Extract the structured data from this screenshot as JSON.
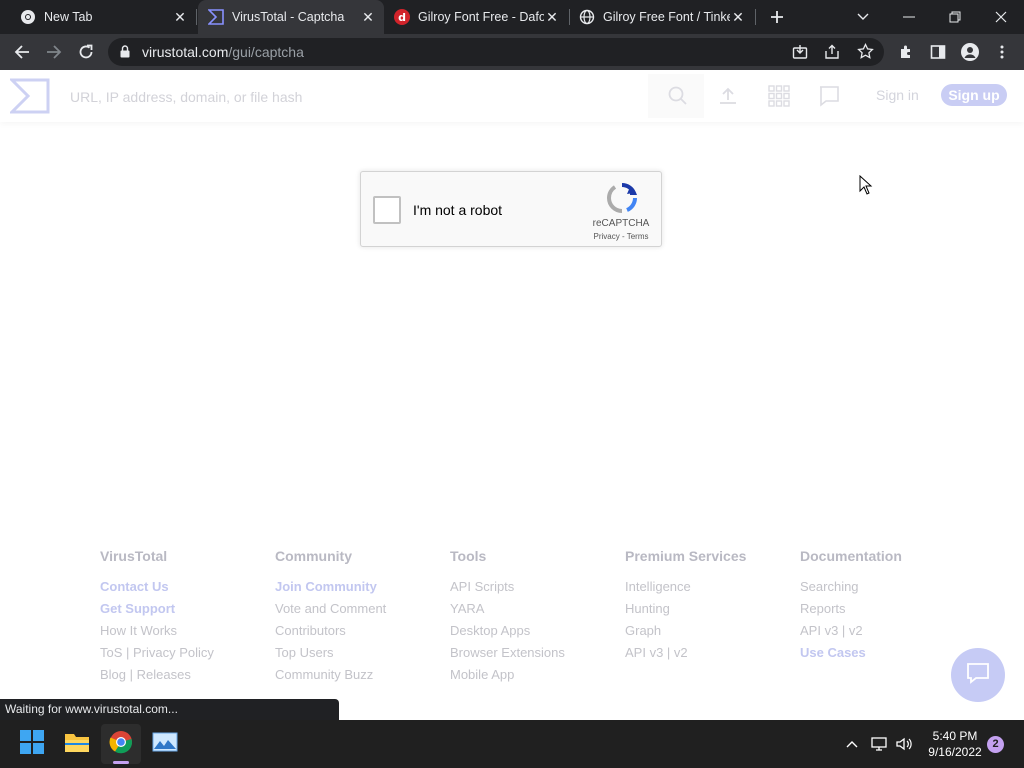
{
  "browser": {
    "tabs": [
      {
        "title": "New Tab",
        "icon": "chrome-icon"
      },
      {
        "title": "VirusTotal - Captcha",
        "icon": "virustotal-icon"
      },
      {
        "title": "Gilroy Font Free - Dafo",
        "icon": "dafont-icon"
      },
      {
        "title": "Gilroy Free Font / Tinke",
        "icon": "globe-icon"
      }
    ],
    "url_host": "virustotal.com",
    "url_path": "/gui/captcha",
    "status_text": "Waiting for www.virustotal.com..."
  },
  "header": {
    "search_placeholder": "URL, IP address, domain, or file hash",
    "sign_in": "Sign in",
    "sign_up": "Sign up"
  },
  "captcha": {
    "label": "I'm not a robot",
    "brand": "reCAPTCHA",
    "links": "Privacy - Terms"
  },
  "footer": {
    "columns": [
      {
        "heading": "VirusTotal",
        "links": [
          "Contact Us",
          "Get Support",
          "How It Works",
          "ToS | Privacy Policy",
          "Blog | Releases"
        ]
      },
      {
        "heading": "Community",
        "links": [
          "Join Community",
          "Vote and Comment",
          "Contributors",
          "Top Users",
          "Community Buzz"
        ]
      },
      {
        "heading": "Tools",
        "links": [
          "API Scripts",
          "YARA",
          "Desktop Apps",
          "Browser Extensions",
          "Mobile App"
        ]
      },
      {
        "heading": "Premium Services",
        "links": [
          "Intelligence",
          "Hunting",
          "Graph",
          "API v3 | v2"
        ]
      },
      {
        "heading": "Documentation",
        "links": [
          "Searching",
          "Reports",
          "API v3 | v2",
          "Use Cases"
        ]
      }
    ]
  },
  "taskbar": {
    "time": "5:40 PM",
    "date": "9/16/2022",
    "notification_count": "2"
  },
  "colors": {
    "accent": "#c2c7f0",
    "tabstrip": "#202124",
    "toolbar": "#35363a"
  }
}
